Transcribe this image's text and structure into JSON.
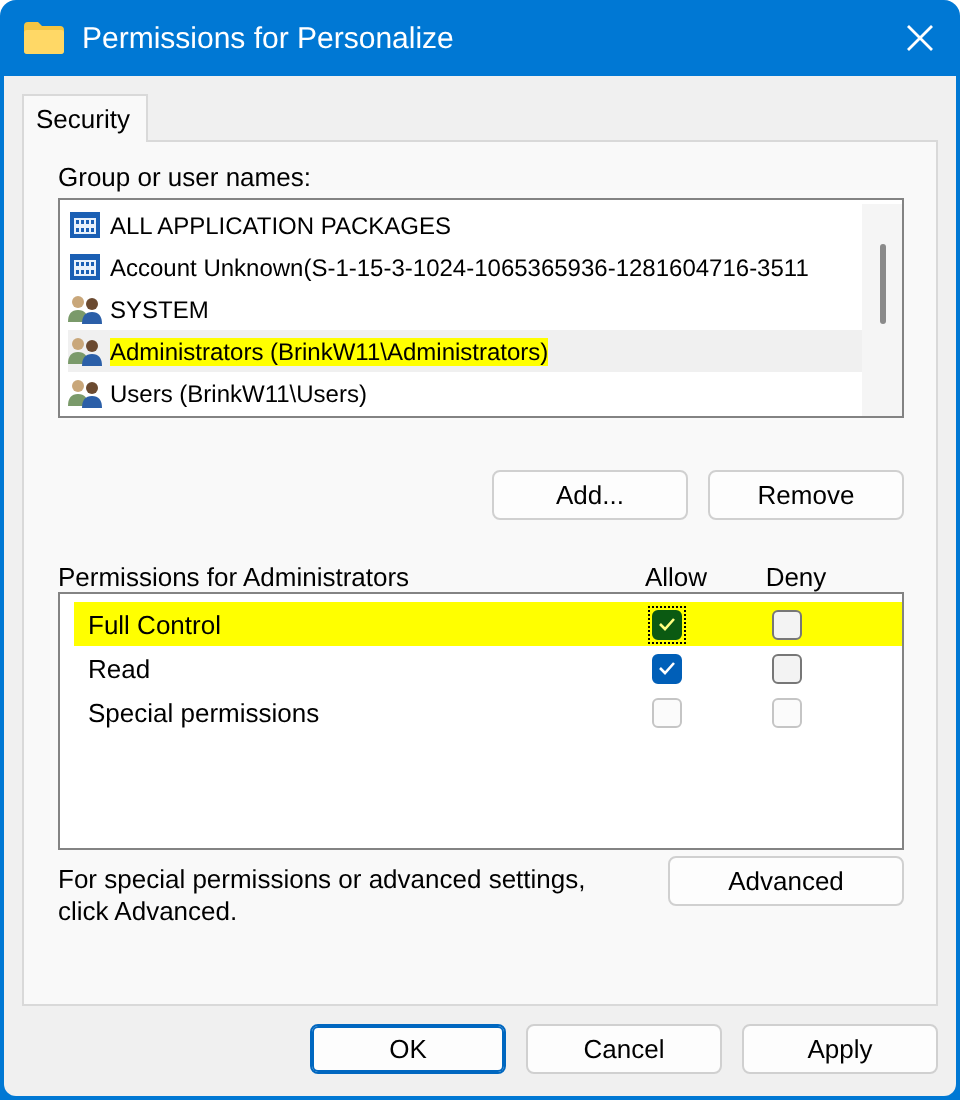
{
  "window": {
    "title": "Permissions for Personalize"
  },
  "tabs": [
    {
      "label": "Security",
      "selected": true
    }
  ],
  "names": {
    "label": "Group or user names:",
    "items": [
      {
        "kind": "package",
        "name": "ALL APPLICATION PACKAGES",
        "selected": false,
        "highlighted": false
      },
      {
        "kind": "package",
        "name": "Account Unknown(S-1-15-3-1024-1065365936-1281604716-3511",
        "selected": false,
        "highlighted": false
      },
      {
        "kind": "group",
        "name": "SYSTEM",
        "selected": false,
        "highlighted": false
      },
      {
        "kind": "group",
        "name": "Administrators (BrinkW11\\Administrators)",
        "selected": true,
        "highlighted": true
      },
      {
        "kind": "group",
        "name": "Users (BrinkW11\\Users)",
        "selected": false,
        "highlighted": false
      }
    ]
  },
  "name_buttons": [
    {
      "label": "Add..."
    },
    {
      "label": "Remove"
    }
  ],
  "permissions": {
    "label": "Permissions for Administrators",
    "allow_heading": "Allow",
    "deny_heading": "Deny",
    "rows": [
      {
        "name": "Full Control",
        "highlighted": true,
        "allow": {
          "checked": true,
          "disabled": false,
          "focused": true
        },
        "deny": {
          "checked": false,
          "disabled": false,
          "focused": false
        }
      },
      {
        "name": "Read",
        "highlighted": false,
        "allow": {
          "checked": true,
          "disabled": false,
          "focused": false
        },
        "deny": {
          "checked": false,
          "disabled": false,
          "focused": false
        }
      },
      {
        "name": "Special permissions",
        "highlighted": false,
        "allow": {
          "checked": false,
          "disabled": true,
          "focused": false
        },
        "deny": {
          "checked": false,
          "disabled": true,
          "focused": false
        }
      }
    ]
  },
  "advanced": {
    "note": "For special permissions or advanced settings, click Advanced.",
    "button": {
      "label": "Advanced"
    }
  },
  "footer_buttons": [
    {
      "label": "OK",
      "default": true
    },
    {
      "label": "Cancel",
      "default": false
    },
    {
      "label": "Apply",
      "default": false
    }
  ]
}
